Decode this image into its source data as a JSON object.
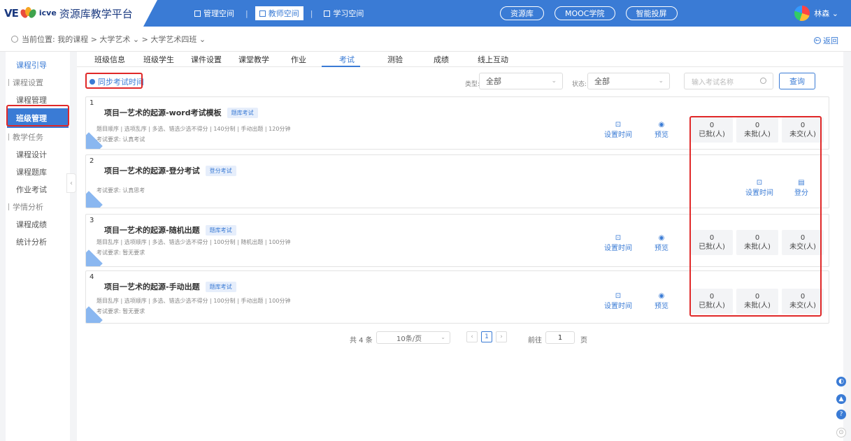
{
  "header": {
    "logo_mark": "VE",
    "logo_icve": "icve",
    "title": "资源库教学平台",
    "spaces": [
      {
        "label": "管理空间"
      },
      {
        "label": "教师空间"
      },
      {
        "label": "学习空间"
      }
    ],
    "links": [
      {
        "label": "资源库"
      },
      {
        "label": "MOOC学院"
      },
      {
        "label": "智能投屏"
      }
    ],
    "user": "林森 ⌄"
  },
  "breadcrumb": {
    "text": "当前位置: 我的课程 > 大学艺术 ⌄ > 大学艺术四班 ⌄",
    "back_label": "返回"
  },
  "sidebar": {
    "items": [
      {
        "label": "课程引导"
      },
      {
        "label": "课程设置"
      },
      {
        "label": "课程管理"
      },
      {
        "label": "班级管理"
      },
      {
        "label": "教学任务"
      },
      {
        "label": "课程设计"
      },
      {
        "label": "课程题库"
      },
      {
        "label": "作业考试"
      },
      {
        "label": "学情分析"
      },
      {
        "label": "课程成绩"
      },
      {
        "label": "统计分析"
      }
    ]
  },
  "tabs": [
    {
      "label": "班级信息"
    },
    {
      "label": "班级学生"
    },
    {
      "label": "课件设置"
    },
    {
      "label": "课堂教学"
    },
    {
      "label": "作业"
    },
    {
      "label": "考试"
    },
    {
      "label": "测验"
    },
    {
      "label": "成绩"
    },
    {
      "label": "线上互动"
    }
  ],
  "toolbar": {
    "sync_label": "同步考试时间",
    "type_label": "类型:",
    "type_value": "全部",
    "status_label": "状态:",
    "status_value": "全部",
    "search_placeholder": "输入考试名称",
    "query_label": "查询"
  },
  "exams": [
    {
      "num": "1",
      "title": "项目一艺术的起源-word考试模板",
      "tag": "题库考试",
      "info": "题目顺序 | 选项乱序 | 多选、错选少选不得分 | 140分制 | 手动出题 | 120分钟",
      "req": "考试要求: 认真考试",
      "set_time": "设置时间",
      "preview": "预览",
      "stats": [
        {
          "value": "0",
          "label": "已批(人)"
        },
        {
          "value": "0",
          "label": "未批(人)"
        },
        {
          "value": "0",
          "label": "未交(人)"
        }
      ]
    },
    {
      "num": "2",
      "title": "项目一艺术的起源-登分考试",
      "tag": "登分考试",
      "req": "考试要求: 认真思考",
      "set_time": "设置时间",
      "score": "登分"
    },
    {
      "num": "3",
      "title": "项目一艺术的起源-随机出题",
      "tag": "题库考试",
      "info": "题目乱序 | 选项顺序 | 多选、错选少选不得分 | 100分制 | 随机出题 | 100分钟",
      "req": "考试要求: 暂无要求",
      "set_time": "设置时间",
      "preview": "预览",
      "stats": [
        {
          "value": "0",
          "label": "已批(人)"
        },
        {
          "value": "0",
          "label": "未批(人)"
        },
        {
          "value": "0",
          "label": "未交(人)"
        }
      ]
    },
    {
      "num": "4",
      "title": "项目一艺术的起源-手动出题",
      "tag": "题库考试",
      "info": "题目乱序 | 选项顺序 | 多选、错选少选不得分 | 100分制 | 手动出题 | 100分钟",
      "req": "考试要求: 暂无要求",
      "set_time": "设置时间",
      "preview": "预览",
      "stats": [
        {
          "value": "0",
          "label": "已批(人)"
        },
        {
          "value": "0",
          "label": "未批(人)"
        },
        {
          "value": "0",
          "label": "未交(人)"
        }
      ]
    }
  ],
  "pagination": {
    "total": "共 4 条",
    "page_size": "10条/页",
    "current": "1",
    "goto_label": "前往",
    "goto_value": "1",
    "page_word": "页"
  },
  "colors": {
    "primary": "#3a7bd5",
    "highlight_red": "#e02828"
  }
}
